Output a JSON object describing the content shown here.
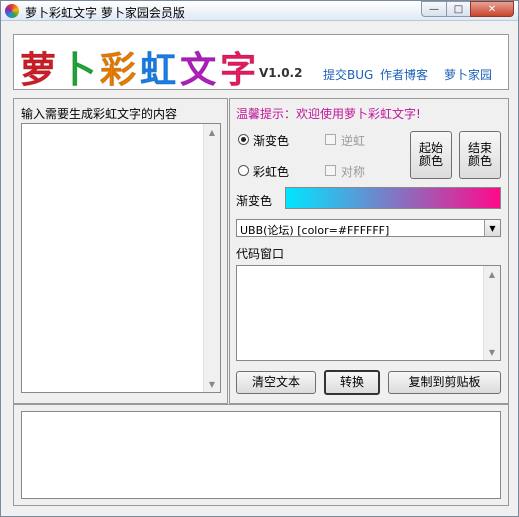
{
  "window": {
    "title": "萝卜彩虹文字 萝卜家园会员版",
    "min_icon": "minimize-icon",
    "max_icon": "maximize-icon",
    "close_icon": "close-icon",
    "min_glyph": "—",
    "max_glyph": "□",
    "close_glyph": "✕"
  },
  "header": {
    "logo_chars": [
      "萝",
      "卜",
      "彩",
      "虹",
      "文",
      "字"
    ],
    "logo_colors": [
      "#e8212b",
      "#1fb43a",
      "#ff8a00",
      "#1c8bff",
      "#c020d0",
      "#ff1d6b"
    ],
    "version": "V1.0.2",
    "links": [
      "提交BUG",
      "作者博客",
      "萝卜家园"
    ]
  },
  "left": {
    "label": "输入需要生成彩虹文字的内容"
  },
  "right": {
    "tip": "温馨提示：欢迎使用萝卜彩虹文字!",
    "radio_gradient": "渐变色",
    "radio_rainbow": "彩虹色",
    "check_reverse": "逆虹",
    "check_symmetric": "对称",
    "btn_start_color": [
      "起始",
      "颜色"
    ],
    "btn_end_color": [
      "结束",
      "颜色"
    ],
    "gradient_label": "渐变色",
    "gradient_colors": [
      "#00e6ff",
      "#ff0a8a"
    ],
    "format_select": "UBB(论坛) [color=#FFFFFF]",
    "code_label": "代码窗口",
    "btn_clear": "清空文本",
    "btn_convert": "转换",
    "btn_copy": "复制到剪贴板"
  }
}
